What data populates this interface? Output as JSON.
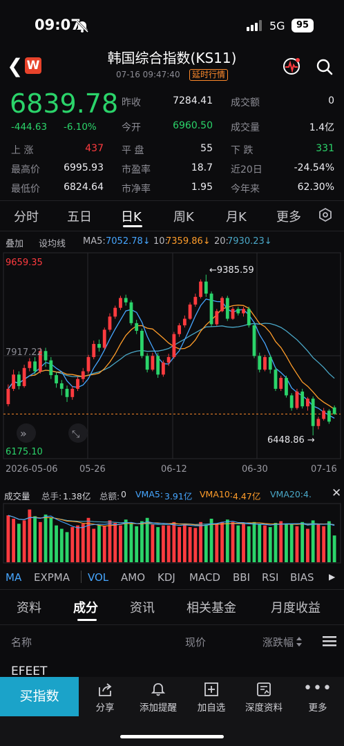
{
  "status": {
    "time": "09:07",
    "network": "5G",
    "battery": "95"
  },
  "header": {
    "logo": "W",
    "title": "韩国综合指数(KS11)",
    "datetime": "07-16 09:47:40",
    "delay_badge": "延时行情"
  },
  "quote": {
    "price": "6839.78",
    "change": "-444.63",
    "change_pct": "-6.10%",
    "stats": [
      {
        "label": "昨收",
        "value": "7284.41"
      },
      {
        "label": "成交额",
        "value": "0"
      },
      {
        "label": "今开",
        "value": "6960.50"
      },
      {
        "label": "成交量",
        "value": "1.4亿"
      },
      {
        "label": "上 涨",
        "value": "437"
      },
      {
        "label": "平 盘",
        "value": "55"
      },
      {
        "label": "下 跌",
        "value": "331"
      },
      {
        "label": "最高价",
        "value": "6995.93"
      },
      {
        "label": "市盈率",
        "value": "18.7"
      },
      {
        "label": "近20日",
        "value": "-24.54%"
      },
      {
        "label": "最低价",
        "value": "6824.64"
      },
      {
        "label": "市净率",
        "value": "1.95"
      },
      {
        "label": "今年来",
        "value": "62.30%"
      }
    ]
  },
  "period_tabs": [
    "分时",
    "五日",
    "日K",
    "周K",
    "月K",
    "更多"
  ],
  "chart_toolbar": {
    "overlay": "叠加",
    "draw": "设均线",
    "ma5_label": "MA5:",
    "ma5": "7052.78↓",
    "ma10_label": "10:",
    "ma10": "7359.86↓",
    "ma20_label": "20:",
    "ma20": "7930.23↓"
  },
  "chart_data": {
    "type": "candlestick",
    "y_top_label": "9659.35",
    "y_mid_label": "7917.22",
    "y_bottom_label": "6175.10",
    "ylim": [
      6175.1,
      9659.35
    ],
    "x_labels": [
      "2026-05-06",
      "05-26",
      "06-12",
      "06-30",
      "07-16"
    ],
    "annotations": [
      {
        "text": "←9385.59"
      },
      {
        "text": "6448.86 →"
      }
    ],
    "reference_line": 6839.78,
    "colors": {
      "up": "#ff3b3f",
      "down": "#2bd46a",
      "ma5": "#46a6ff",
      "ma10": "#ff9d2a",
      "ma20": "#4aa8c8"
    },
    "candles": [
      [
        7020,
        7300,
        6980,
        7380
      ],
      [
        7300,
        7560,
        7260,
        7650
      ],
      [
        7560,
        7350,
        7290,
        7620
      ],
      [
        7350,
        7680,
        7320,
        7740
      ],
      [
        7680,
        7800,
        7620,
        7860
      ],
      [
        7800,
        7620,
        7560,
        7880
      ],
      [
        7620,
        7990,
        7580,
        8050
      ],
      [
        7990,
        7820,
        7700,
        8050
      ],
      [
        7820,
        7550,
        7480,
        7880
      ],
      [
        7550,
        7400,
        7320,
        7600
      ],
      [
        7400,
        7300,
        7180,
        7460
      ],
      [
        7300,
        7150,
        7060,
        7360
      ],
      [
        7150,
        7300,
        7100,
        7350
      ],
      [
        7300,
        7480,
        7260,
        7520
      ],
      [
        7480,
        7620,
        7420,
        7680
      ],
      [
        7620,
        7880,
        7580,
        7920
      ],
      [
        7880,
        8120,
        7840,
        8180
      ],
      [
        8120,
        8050,
        7980,
        8200
      ],
      [
        8050,
        8380,
        8020,
        8420
      ],
      [
        8380,
        8620,
        8340,
        8680
      ],
      [
        8620,
        8780,
        8580,
        8820
      ],
      [
        8780,
        8960,
        8740,
        9000
      ],
      [
        8960,
        8880,
        8820,
        9020
      ],
      [
        8880,
        8500,
        8460,
        8920
      ],
      [
        8500,
        8360,
        8300,
        8560
      ],
      [
        8360,
        7900,
        7860,
        8400
      ],
      [
        7900,
        7650,
        7600,
        7950
      ],
      [
        7650,
        7900,
        7620,
        7960
      ],
      [
        7900,
        7560,
        7500,
        7960
      ],
      [
        7560,
        7780,
        7520,
        7820
      ],
      [
        7780,
        7880,
        7720,
        7940
      ],
      [
        7880,
        8300,
        7850,
        8340
      ],
      [
        8300,
        8460,
        8250,
        8500
      ],
      [
        8460,
        8580,
        8420,
        8640
      ],
      [
        8580,
        8840,
        8560,
        8880
      ],
      [
        8840,
        8980,
        8800,
        9040
      ],
      [
        8980,
        9260,
        8950,
        9300
      ],
      [
        9260,
        9040,
        8980,
        9386
      ],
      [
        9040,
        8480,
        8440,
        9080
      ],
      [
        8480,
        8720,
        8450,
        8760
      ],
      [
        8720,
        8960,
        8700,
        8990
      ],
      [
        8960,
        8580,
        8540,
        9000
      ],
      [
        8580,
        8760,
        8560,
        8800
      ],
      [
        8760,
        8680,
        8640,
        8800
      ],
      [
        8680,
        8760,
        8620,
        8800
      ],
      [
        8760,
        8460,
        8420,
        8800
      ],
      [
        8460,
        7900,
        7860,
        8500
      ],
      [
        7900,
        7650,
        7600,
        7960
      ],
      [
        7650,
        7880,
        7620,
        7920
      ],
      [
        7880,
        7650,
        7580,
        7920
      ],
      [
        7650,
        7300,
        7260,
        7700
      ],
      [
        7300,
        7500,
        7260,
        7540
      ],
      [
        7500,
        7180,
        7140,
        7540
      ],
      [
        7180,
        6950,
        6900,
        7220
      ],
      [
        6950,
        7250,
        6920,
        7300
      ],
      [
        7250,
        6980,
        6940,
        7300
      ],
      [
        6980,
        7120,
        6900,
        7150
      ],
      [
        7120,
        6620,
        6449,
        7160
      ],
      [
        6620,
        6750,
        6560,
        6790
      ],
      [
        6750,
        6900,
        6720,
        6950
      ],
      [
        6900,
        6700,
        6660,
        6930
      ],
      [
        6960,
        6840,
        6825,
        6996
      ]
    ]
  },
  "volume": {
    "title": "成交量",
    "total_label": "总手:",
    "total": "1.38亿",
    "amount_label": "总额:",
    "amount": "0",
    "vma5_label": "VMA5:",
    "vma5": "3.91亿",
    "vma10_label": "VMA10:",
    "vma10": "4.47亿",
    "vma20_label": "VMA20:",
    "vma20": "4.",
    "values": [
      5.6,
      5.2,
      4.6,
      5.0,
      6.3,
      5.5,
      4.8,
      5.7,
      5.3,
      4.4,
      4.0,
      3.6,
      4.2,
      4.4,
      4.6,
      5.3,
      4.0,
      4.4,
      4.3,
      5.0,
      4.7,
      4.4,
      5.1,
      4.6,
      4.3,
      4.9,
      5.3,
      4.5,
      4.2,
      4.4,
      4.4,
      4.8,
      4.2,
      4.5,
      4.2,
      4.1,
      4.8,
      4.5,
      5.2,
      4.6,
      4.8,
      5.1,
      4.8,
      4.4,
      4.6,
      4.3,
      4.8,
      4.5,
      4.4,
      4.2,
      4.7,
      4.9,
      4.6,
      4.5,
      4.3,
      4.8,
      4.0,
      5.0,
      4.6,
      4.3,
      4.9,
      3.2
    ]
  },
  "indicators": [
    "MA",
    "EXPMA",
    "VOL",
    "AMO",
    "KDJ",
    "MACD",
    "BBI",
    "RSI",
    "BIAS"
  ],
  "info_tabs": [
    "资料",
    "成分",
    "资讯",
    "相关基金",
    "月度收益"
  ],
  "list_header": {
    "name": "名称",
    "price": "现价",
    "change": "涨跌幅"
  },
  "list_first_row": "EFEET",
  "bottom_bar": {
    "buy": "买指数",
    "items": [
      {
        "icon": "share-icon",
        "label": "分享"
      },
      {
        "icon": "bell-icon",
        "label": "添加提醒"
      },
      {
        "icon": "plus-square-icon",
        "label": "加自选"
      },
      {
        "icon": "document-icon",
        "label": "深度资料"
      },
      {
        "icon": "more-icon",
        "label": "更多"
      }
    ]
  }
}
